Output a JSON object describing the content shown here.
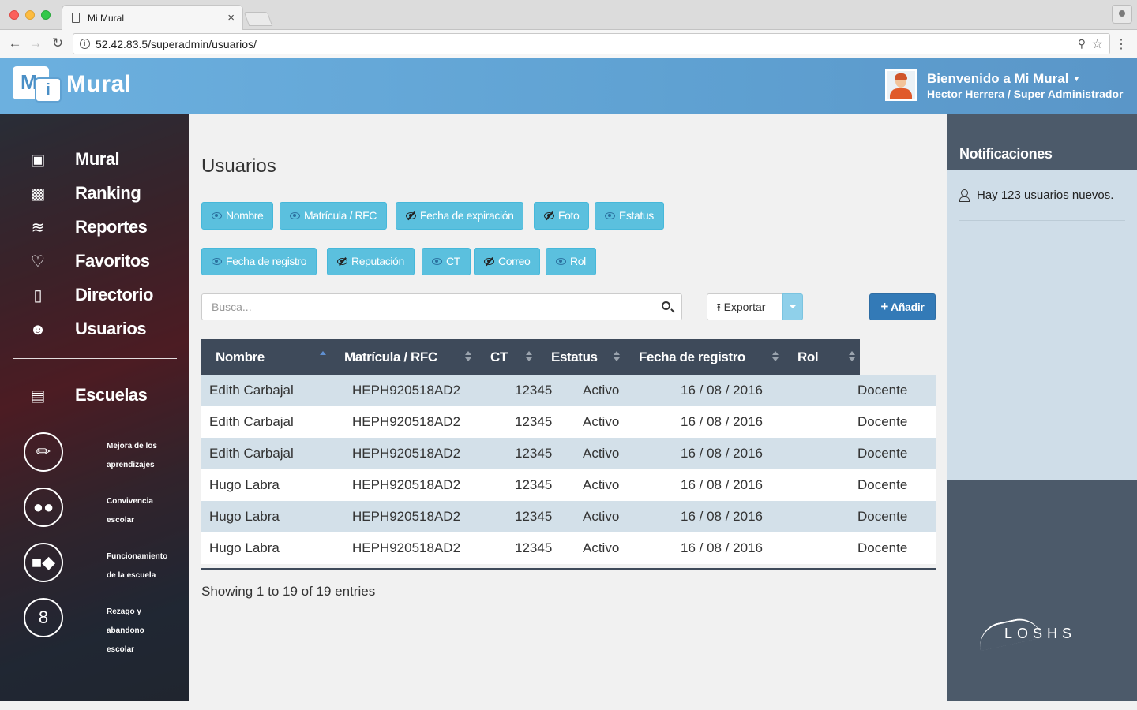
{
  "browser": {
    "tab_title": "Mi Mural",
    "tab_close": "×",
    "url": "52.42.83.5/superadmin/usuarios/"
  },
  "header": {
    "logo_m": "M",
    "logo_i": "i",
    "logo_text": "Mural",
    "welcome": "Bienvenido a Mi Mural",
    "user_line": "Hector Herrera / Super Administrador"
  },
  "sidebar": {
    "items": [
      {
        "label": "Mural",
        "icon": "mural-icon"
      },
      {
        "label": "Ranking",
        "icon": "ranking-icon"
      },
      {
        "label": "Reportes",
        "icon": "reportes-icon"
      },
      {
        "label": "Favoritos",
        "icon": "heart-icon"
      },
      {
        "label": "Directorio",
        "icon": "directorio-icon"
      },
      {
        "label": "Usuarios",
        "icon": "user-icon"
      }
    ],
    "schools": {
      "label": "Escuelas",
      "icon": "bus-icon"
    },
    "programs": [
      {
        "line1": "Mejora de los",
        "line2": "aprendizajes",
        "line3": ""
      },
      {
        "line1": "Convivencia",
        "line2": "escolar",
        "line3": ""
      },
      {
        "line1": "Funcionamiento",
        "line2": "de la escuela",
        "line3": ""
      },
      {
        "line1": "Rezago y",
        "line2": "abandono",
        "line3": "escolar"
      }
    ]
  },
  "main": {
    "title": "Usuarios",
    "column_toggles_row1": [
      {
        "label": "Nombre",
        "visible": true
      },
      {
        "label": "Matrícula / RFC",
        "visible": true
      },
      {
        "label": "Fecha de expiración",
        "visible": false
      },
      {
        "label": "Foto",
        "visible": false
      },
      {
        "label": "Estatus",
        "visible": true
      }
    ],
    "column_toggles_row2": [
      {
        "label": "Fecha de registro",
        "visible": true
      },
      {
        "label": "Reputación",
        "visible": false
      },
      {
        "label": "CT",
        "visible": true
      },
      {
        "label": "Correo",
        "visible": false
      },
      {
        "label": "Rol",
        "visible": true
      }
    ],
    "search_placeholder": "Busca...",
    "export_label": "Exportar",
    "add_label": "Añadir",
    "table": {
      "headers": [
        "Nombre",
        "Matrícula / RFC",
        "CT",
        "Estatus",
        "Fecha de registro",
        "Rol"
      ],
      "rows": [
        [
          "Edith Carbajal",
          "HEPH920518AD2",
          "12345",
          "Activo",
          "16 / 08 / 2016",
          "Docente"
        ],
        [
          "Edith Carbajal",
          "HEPH920518AD2",
          "12345",
          "Activo",
          "16 / 08 / 2016",
          "Docente"
        ],
        [
          "Edith Carbajal",
          "HEPH920518AD2",
          "12345",
          "Activo",
          "16 / 08 / 2016",
          "Docente"
        ],
        [
          "Hugo Labra",
          "HEPH920518AD2",
          "12345",
          "Activo",
          "16 / 08 / 2016",
          "Docente"
        ],
        [
          "Hugo Labra",
          "HEPH920518AD2",
          "12345",
          "Activo",
          "16 / 08 / 2016",
          "Docente"
        ],
        [
          "Hugo Labra",
          "HEPH920518AD2",
          "12345",
          "Activo",
          "16 / 08 / 2016",
          "Docente"
        ]
      ]
    },
    "entries": "Showing 1 to 19 of 19 entries"
  },
  "notifications": {
    "title": "Notificaciones",
    "items": [
      "Hay 123 usuarios nuevos."
    ],
    "brand": "LOSHS"
  },
  "colors": {
    "header_blue": "#5fa1d2",
    "toggle_blue": "#5bc0de",
    "add_blue": "#337ab7",
    "table_head": "#3e4a5a",
    "row_alt": "#d3e0e9",
    "panel_dark": "#4c5a6a"
  }
}
